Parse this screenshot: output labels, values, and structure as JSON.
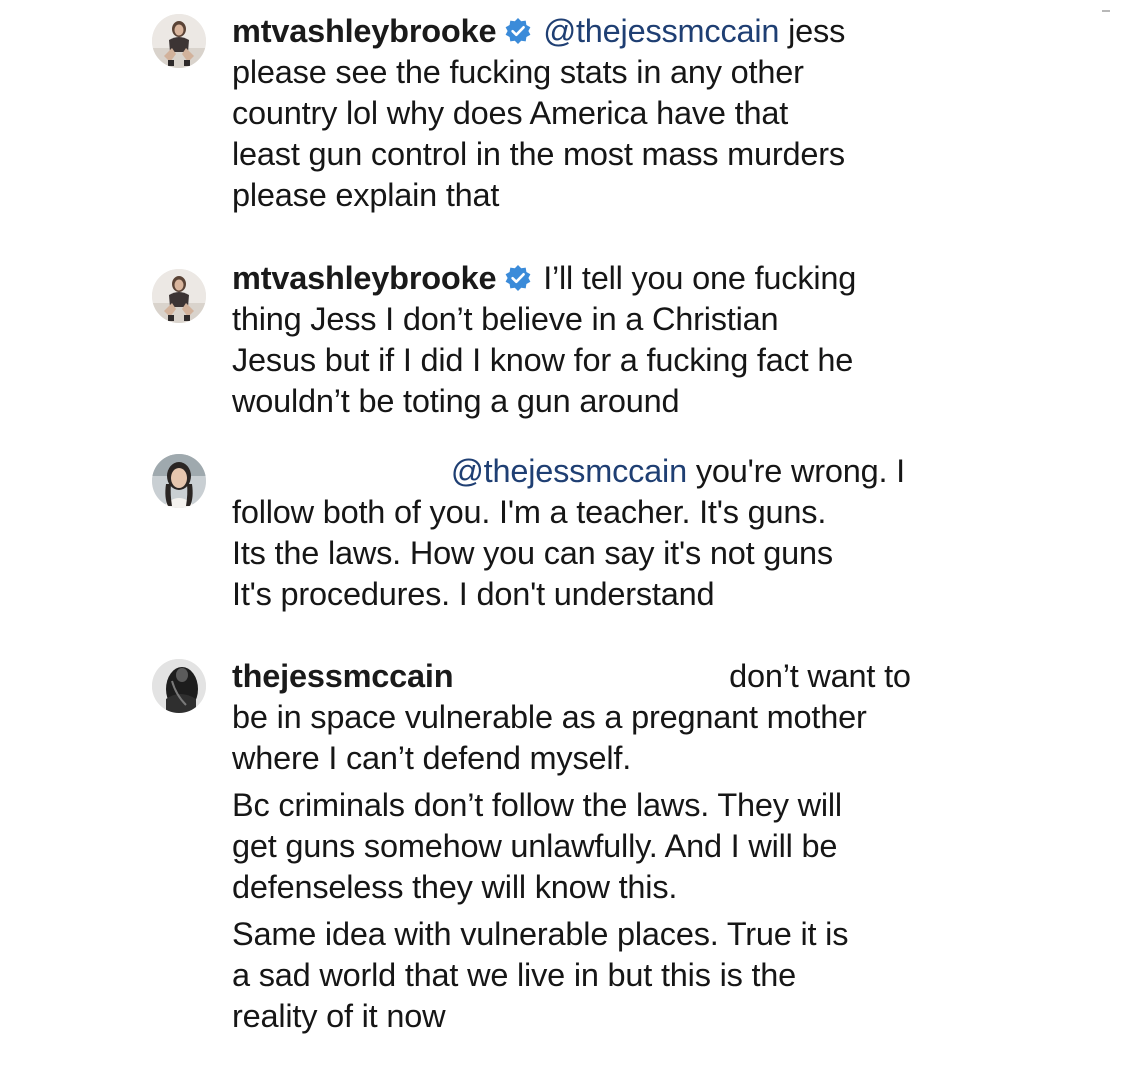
{
  "colors": {
    "text": "#161616",
    "mention": "#1f3f73",
    "verified": "#3b8bd9",
    "background": "#ffffff"
  },
  "comments": [
    {
      "username": "mtvashleybrooke",
      "verified": true,
      "avatar": "avatar-woman-sitting",
      "lines": [
        "jess",
        "please see the fucking stats in any other",
        "country lol why does America have that",
        "least gun control in the most mass murders",
        "please explain that"
      ],
      "mention": "@thejessmccain"
    },
    {
      "username": "mtvashleybrooke",
      "verified": true,
      "avatar": "avatar-woman-sitting",
      "lines": [
        "I’ll tell you one fucking",
        "thing Jess I don’t believe in a Christian",
        "Jesus but if I did I know for a fucking fact he",
        "wouldn’t be toting a gun around"
      ]
    },
    {
      "username": "",
      "verified": false,
      "avatar": "avatar-woman-portrait",
      "mention": "@thejessmccain",
      "lines": [
        "you're wrong. I",
        "follow both of you. I'm a teacher. It's guns.",
        "Its the laws. How you can say it's not guns",
        "It's procedures.  I don't understand"
      ]
    },
    {
      "username": "thejessmccain",
      "verified": false,
      "avatar": "avatar-dark-photo",
      "first_line_tail": "don’t want to",
      "paragraphs": [
        [
          "be in space vulnerable as a pregnant mother",
          "where I can’t defend myself."
        ],
        [
          "Bc criminals don’t follow the laws. They will",
          "get guns somehow unlawfully. And I will be",
          "defenseless they will know this."
        ],
        [
          "Same idea with vulnerable places. True it is",
          "a sad world that we live in but this is the",
          "reality of it now"
        ]
      ]
    }
  ]
}
